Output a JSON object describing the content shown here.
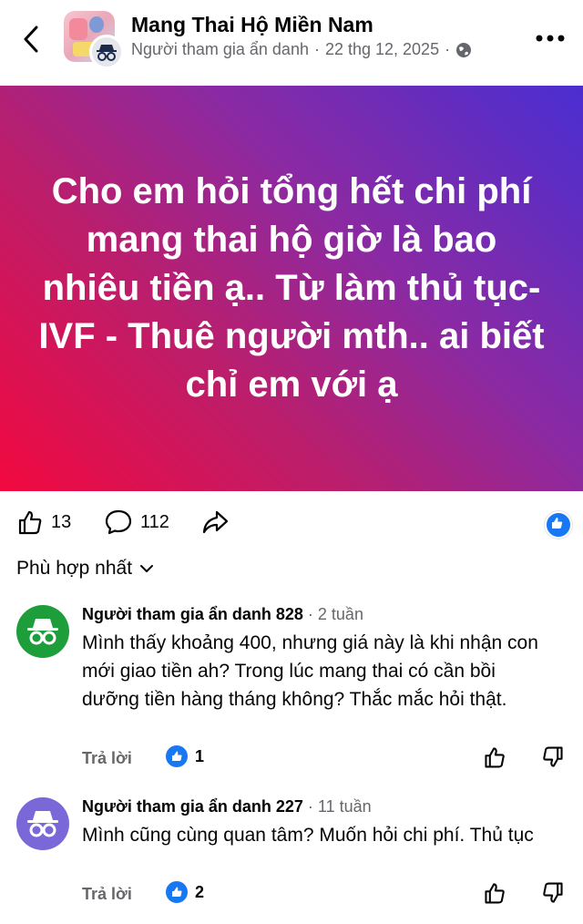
{
  "header": {
    "group_name": "Mang Thai Hộ Miền Nam",
    "author": "Người tham gia ẩn danh",
    "separator": "·",
    "date": "22 thg 12, 2025",
    "separator2": "·"
  },
  "post": {
    "text": "Cho em hỏi tổng hết chi phí mang thai hộ giờ là bao nhiêu tiền ạ.. Từ làm thủ tục- IVF - Thuê người mth.. ai biết chỉ em với ạ",
    "background_colors": [
      "#f2093f",
      "#8a2aa3",
      "#4a2ed1"
    ]
  },
  "stats": {
    "likes": "13",
    "comments": "112"
  },
  "sort": {
    "label": "Phù hợp nhất"
  },
  "comments": [
    {
      "author": "Người tham gia ẩn danh 828",
      "time": "2 tuần",
      "text": "Mình thấy khoảng 400, nhưng giá này là khi nhận con mới giao tiền ah? Trong lúc mang thai có cần bồi dưỡng tiền hàng tháng không? Thắc mắc hỏi thật.",
      "reply_label": "Trả lời",
      "likes": "1",
      "avatar_color": "#1e9e3a"
    },
    {
      "author": "Người tham gia ẩn danh 227",
      "time": "11 tuần",
      "text": "Mình cũng cùng quan tâm? Muốn hỏi chi phí. Thủ tục",
      "reply_label": "Trả lời",
      "likes": "2",
      "avatar_color": "#7b68d8"
    }
  ],
  "colors": {
    "accent": "#1877f2",
    "muted_text": "#65676b"
  }
}
